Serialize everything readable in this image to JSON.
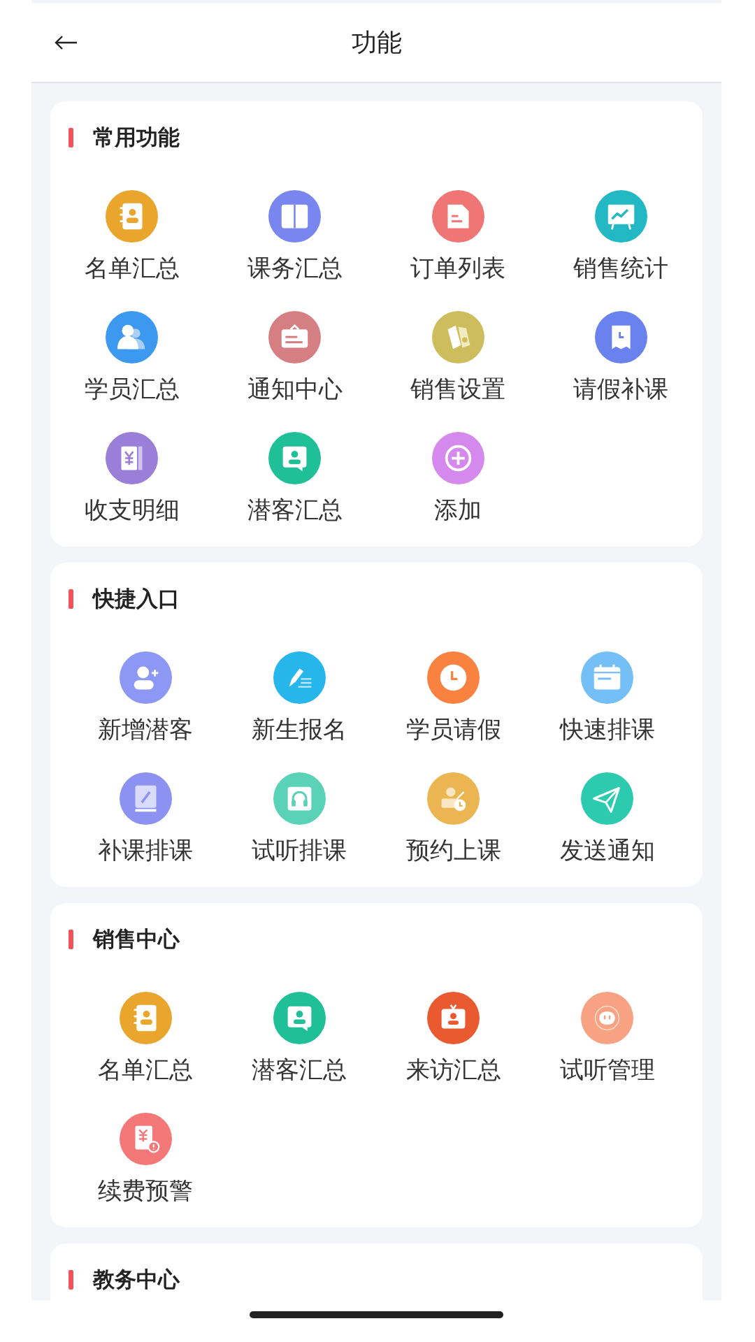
{
  "header": {
    "title": "功能"
  },
  "sections": [
    {
      "title": "常用功能",
      "items": [
        {
          "label": "名单汇总",
          "kind": "contacts",
          "color": "#e9a52c"
        },
        {
          "label": "课务汇总",
          "kind": "book",
          "color": "#7a86f0"
        },
        {
          "label": "订单列表",
          "kind": "document",
          "color": "#f07575"
        },
        {
          "label": "销售统计",
          "kind": "chart",
          "color": "#22b9c4"
        },
        {
          "label": "学员汇总",
          "kind": "users",
          "color": "#3d98ef"
        },
        {
          "label": "通知中心",
          "kind": "notice",
          "color": "#d67f82"
        },
        {
          "label": "销售设置",
          "kind": "tags",
          "color": "#cdbd5c"
        },
        {
          "label": "请假补课",
          "kind": "leave",
          "color": "#6a82ee"
        },
        {
          "label": "收支明细",
          "kind": "ledger",
          "color": "#9a7fd8"
        },
        {
          "label": "潜客汇总",
          "kind": "profile",
          "color": "#1fbf98"
        },
        {
          "label": "添加",
          "kind": "add",
          "color": "#d689ec"
        }
      ]
    },
    {
      "title": "快捷入口",
      "items": [
        {
          "label": "新增潜客",
          "kind": "useradd",
          "color": "#8d98f4"
        },
        {
          "label": "新生报名",
          "kind": "pen",
          "color": "#26b6ec"
        },
        {
          "label": "学员请假",
          "kind": "clock",
          "color": "#f98240"
        },
        {
          "label": "快速排课",
          "kind": "calendar",
          "color": "#74bff5"
        },
        {
          "label": "补课排课",
          "kind": "notebook",
          "color": "#8c92f1"
        },
        {
          "label": "试听排课",
          "kind": "headset",
          "color": "#5ad2b8"
        },
        {
          "label": "预约上课",
          "kind": "appointment",
          "color": "#ebb651"
        },
        {
          "label": "发送通知",
          "kind": "send",
          "color": "#2ccbb0"
        }
      ]
    },
    {
      "title": "销售中心",
      "items": [
        {
          "label": "名单汇总",
          "kind": "contacts",
          "color": "#e9a52c"
        },
        {
          "label": "潜客汇总",
          "kind": "profile",
          "color": "#1fbf98"
        },
        {
          "label": "来访汇总",
          "kind": "visit",
          "color": "#ea5a30"
        },
        {
          "label": "试听管理",
          "kind": "robot",
          "color": "#f6a283"
        },
        {
          "label": "续费预警",
          "kind": "bill",
          "color": "#f57878"
        }
      ]
    },
    {
      "title": "教务中心"
    }
  ]
}
